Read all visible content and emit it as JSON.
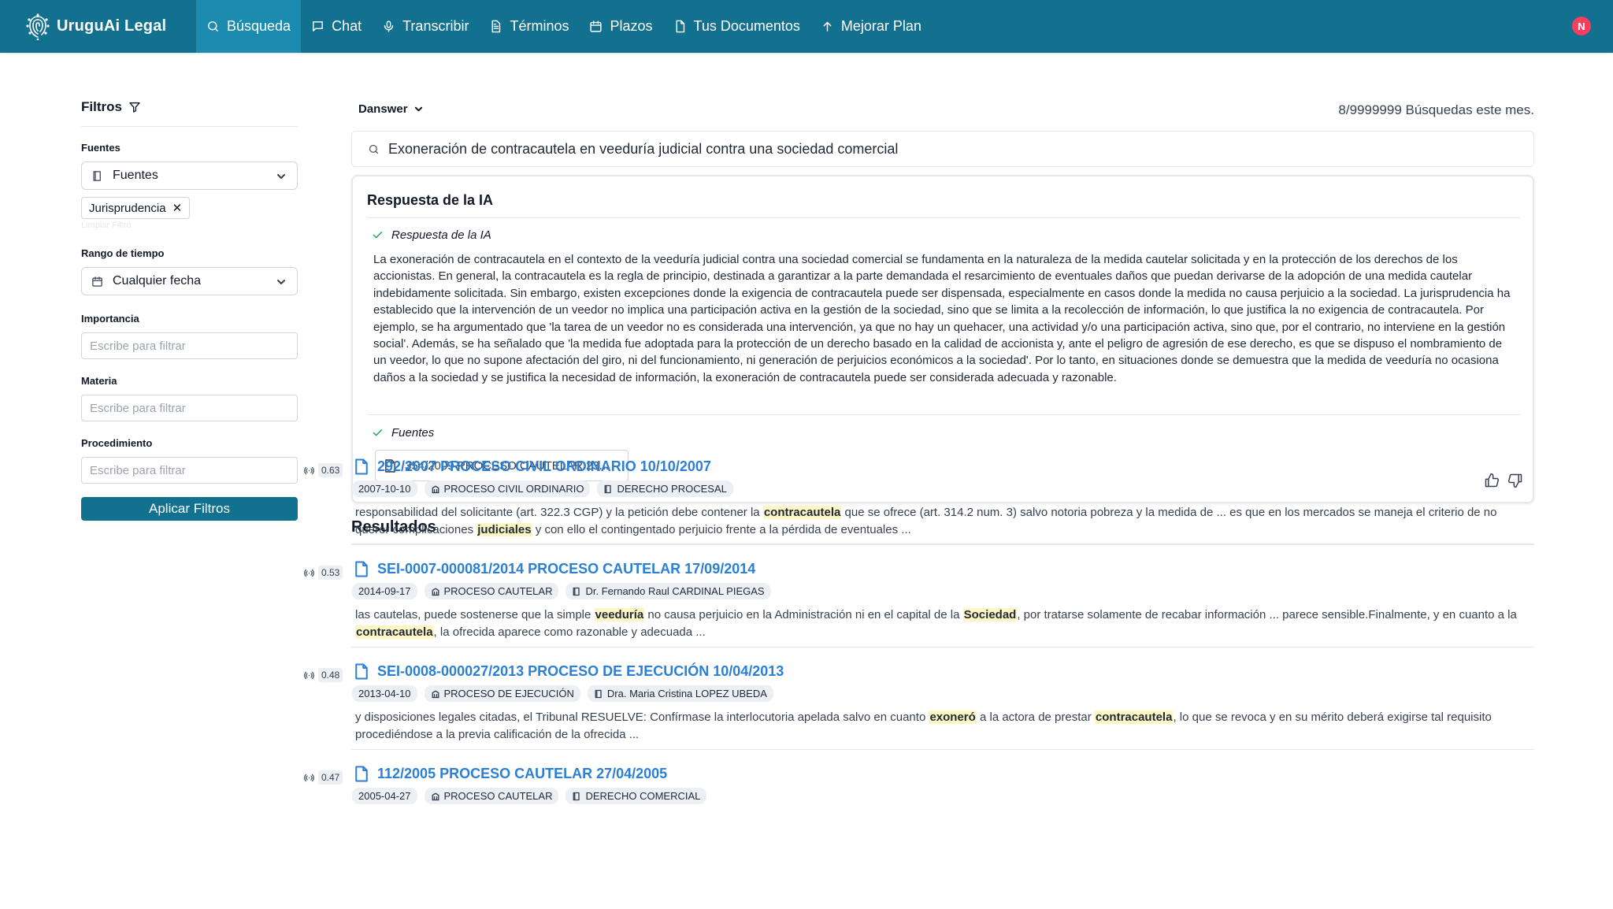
{
  "app": {
    "name": "UruguAi Legal",
    "avatar_initial": "N"
  },
  "nav": {
    "items": [
      {
        "label": "Búsqueda",
        "icon": "search-icon",
        "active": true
      },
      {
        "label": "Chat",
        "icon": "chat-icon",
        "active": false
      },
      {
        "label": "Transcribir",
        "icon": "microphone-icon",
        "active": false
      },
      {
        "label": "Términos",
        "icon": "document-icon",
        "active": false
      },
      {
        "label": "Plazos",
        "icon": "calendar-icon",
        "active": false
      },
      {
        "label": "Tus Documentos",
        "icon": "file-icon",
        "active": false
      },
      {
        "label": "Mejorar Plan",
        "icon": "arrow-up-icon",
        "active": false
      }
    ]
  },
  "filters": {
    "title": "Filtros",
    "fuentes_label": "Fuentes",
    "fuentes_select": "Fuentes",
    "selected_chip": "Jurisprudencia",
    "clear_label": "Limpiar Filtro",
    "rango_label": "Rango de tiempo",
    "rango_value": "Cualquier fecha",
    "importancia_label": "Importancia",
    "materia_label": "Materia",
    "procedimiento_label": "Procedimiento",
    "text_placeholder": "Escribe para filtrar",
    "apply_label": "Aplicar Filtros"
  },
  "search": {
    "engine": "Danswer",
    "usage": "8/9999999 Búsquedas este mes.",
    "query": "Exoneración de contracautela en veeduría judicial contra una sociedad comercial"
  },
  "ai_answer": {
    "card_title": "Respuesta de la IA",
    "answer_label": "Respuesta de la IA",
    "text": "La exoneración de contracautela en el contexto de la veeduría judicial contra una sociedad comercial se fundamenta en la naturaleza de la medida cautelar solicitada y en la protección de los derechos de los accionistas. En general, la contracautela es la regla de principio, destinada a garantizar a la parte demandada el resarcimiento de eventuales daños que puedan derivarse de la adopción de una medida cautelar indebidamente solicitada. Sin embargo, existen excepciones donde la exigencia de contracautela puede ser dispensada, especialmente en casos donde la medida no causa perjuicio a la sociedad. La jurisprudencia ha establecido que la intervención de un veedor no implica una participación activa en la gestión de la sociedad, sino que se limita a la recolección de información, lo que justifica la no exigencia de contracautela. Por ejemplo, se ha argumentado que 'la tarea de un veedor no es considerada una intervención, ya que no hay un quehacer, una actividad y/o una participación activa, sino que, por el contrario, no interviene en la gestión social'. Además, se ha señalado que 'la medida fue adoptada para la protección de un derecho basado en la calidad de accionista y, ante el peligro de agresión de ese derecho, es que se dispuso el nombramiento de un veedor, lo que no supone afectación del giro, ni del funcionamiento, ni generación de perjuicios económicos a la sociedad'. Por lo tanto, en situaciones donde se demuestra que la medida de veeduría no ocasiona daños a la sociedad y se justifica la necesidad de información, la exoneración de contracautela puede ser considerada adecuada y razonable.",
    "sources_label": "Fuentes",
    "source_chip": "354/2009 PROCESO CAUTELAR 23..."
  },
  "results": {
    "title": "Resultados",
    "items": [
      {
        "score": "0.63",
        "title": "292/2007 PROCESO CIVIL ORDINARIO 10/10/2007",
        "date": "2007-10-10",
        "type": "PROCESO CIVIL ORDINARIO",
        "extra": "DERECHO PROCESAL",
        "snippet": [
          {
            "t": "responsabilidad del solicitante (art. 322.3 CGP) y la petición debe contener la ",
            "h": false
          },
          {
            "t": "contracautela",
            "h": true
          },
          {
            "t": " que se ofrece (art. 314.2 num. 3) salvo notoria pobreza y la medida de ... es que en los mercados se maneja el criterio de no querer complicaciones ",
            "h": false
          },
          {
            "t": "judiciales",
            "h": true
          },
          {
            "t": " y con ello el contingentado perjuicio frente a la pérdida de eventuales ...",
            "h": false
          }
        ]
      },
      {
        "score": "0.53",
        "title": "SEI-0007-000081/2014 PROCESO CAUTELAR 17/09/2014",
        "date": "2014-09-17",
        "type": "PROCESO CAUTELAR",
        "extra": "Dr. Fernando Raul CARDINAL PIEGAS",
        "snippet": [
          {
            "t": "las cautelas, puede sostenerse que la simple ",
            "h": false
          },
          {
            "t": "veeduría",
            "h": true
          },
          {
            "t": " no causa perjuicio en la Administración ni en el capital de la ",
            "h": false
          },
          {
            "t": "Sociedad",
            "h": true
          },
          {
            "t": ", por tratarse solamente de recabar información ... parece sensible.Finalmente, y en cuanto a la ",
            "h": false
          },
          {
            "t": "contracautela",
            "h": true
          },
          {
            "t": ", la ofrecida aparece como razonable y adecuada ...",
            "h": false
          }
        ]
      },
      {
        "score": "0.48",
        "title": "SEI-0008-000027/2013 PROCESO DE EJECUCIÓN 10/04/2013",
        "date": "2013-04-10",
        "type": "PROCESO DE EJECUCIÓN",
        "extra": "Dra. Maria Cristina LOPEZ UBEDA",
        "snippet": [
          {
            "t": "y disposiciones legales citadas, el Tribunal RESUELVE: Confírmase la interlocutoria apelada salvo en cuanto ",
            "h": false
          },
          {
            "t": "exoneró",
            "h": true
          },
          {
            "t": " a la actora de prestar ",
            "h": false
          },
          {
            "t": "contracautela",
            "h": true
          },
          {
            "t": ", lo que se revoca y en su mérito deberá exigirse tal requisito procediéndose a la previa calificación de la ofrecida ...",
            "h": false
          }
        ]
      },
      {
        "score": "0.47",
        "title": "112/2005 PROCESO CAUTELAR 27/04/2005",
        "date": "2005-04-27",
        "type": "PROCESO CAUTELAR",
        "extra": "DERECHO COMERCIAL",
        "snippet": []
      }
    ]
  },
  "colors": {
    "navbar": "#12718f",
    "nav_active": "#1b8bb0",
    "link": "#2b7fd4",
    "highlight": "#fdf6c3",
    "check": "#16a34a",
    "avatar": "#f43f5e"
  }
}
